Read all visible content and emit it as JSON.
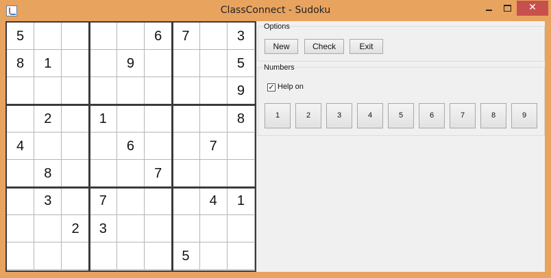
{
  "window": {
    "title": "ClassConnect - Sudoku",
    "close_glyph": "✕",
    "icon": "java-app-icon",
    "title_bar_color": "#e8a35f",
    "close_button_color": "#c7504d"
  },
  "board": {
    "rows": [
      [
        "5",
        "",
        "",
        "",
        "",
        "6",
        "7",
        "",
        "3"
      ],
      [
        "8",
        "1",
        "",
        "",
        "9",
        "",
        "",
        "",
        "5"
      ],
      [
        "",
        "",
        "",
        "",
        "",
        "",
        "",
        "",
        "9"
      ],
      [
        "",
        "2",
        "",
        "1",
        "",
        "",
        "",
        "",
        "8"
      ],
      [
        "4",
        "",
        "",
        "",
        "6",
        "",
        "",
        "7",
        ""
      ],
      [
        "",
        "8",
        "",
        "",
        "",
        "7",
        "",
        "",
        ""
      ],
      [
        "",
        "3",
        "",
        "7",
        "",
        "",
        "",
        "4",
        "1"
      ],
      [
        "",
        "",
        "2",
        "3",
        "",
        "",
        "",
        "",
        ""
      ],
      [
        "",
        "",
        "",
        "",
        "",
        "",
        "5",
        "",
        ""
      ]
    ]
  },
  "options": {
    "label": "Options",
    "new_label": "New",
    "check_label": "Check",
    "exit_label": "Exit"
  },
  "numbers": {
    "label": "Numbers",
    "help_checkbox": {
      "label": "Help on",
      "checked": true,
      "mark": "✓"
    },
    "buttons": [
      "1",
      "2",
      "3",
      "4",
      "5",
      "6",
      "7",
      "8",
      "9"
    ]
  }
}
